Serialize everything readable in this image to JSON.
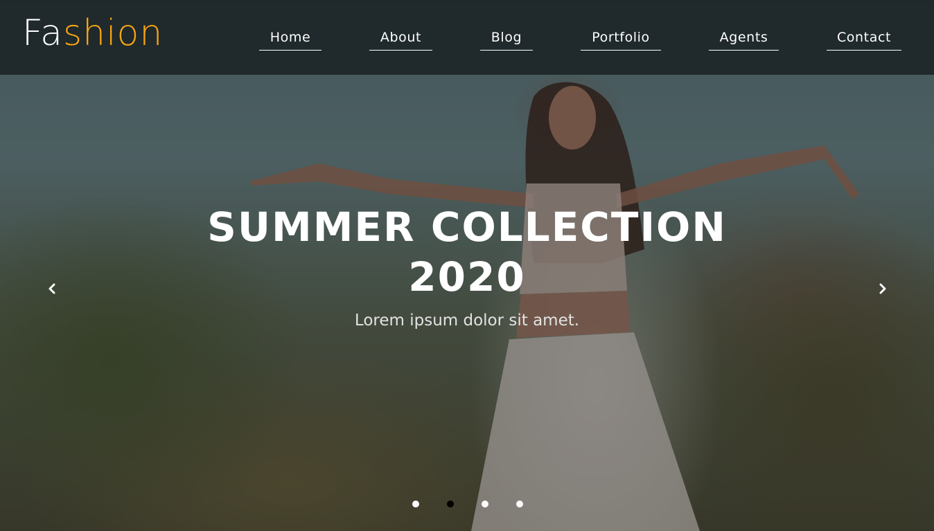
{
  "brand": {
    "part1": "Fa",
    "part2": "shion",
    "accent_color": "#f5a413"
  },
  "nav": {
    "items": [
      {
        "label": "Home"
      },
      {
        "label": "About"
      },
      {
        "label": "Blog"
      },
      {
        "label": "Portfolio"
      },
      {
        "label": "Agents"
      },
      {
        "label": "Contact"
      }
    ]
  },
  "slide": {
    "title_line1": "SUMMER COLLECTION",
    "title_line2": "2020",
    "subtitle": "Lorem ipsum dolor sit amet."
  },
  "carousel": {
    "prev_icon": "chevron-left-icon",
    "next_icon": "chevron-right-icon",
    "indicator_count": 4,
    "active_index": 1
  }
}
